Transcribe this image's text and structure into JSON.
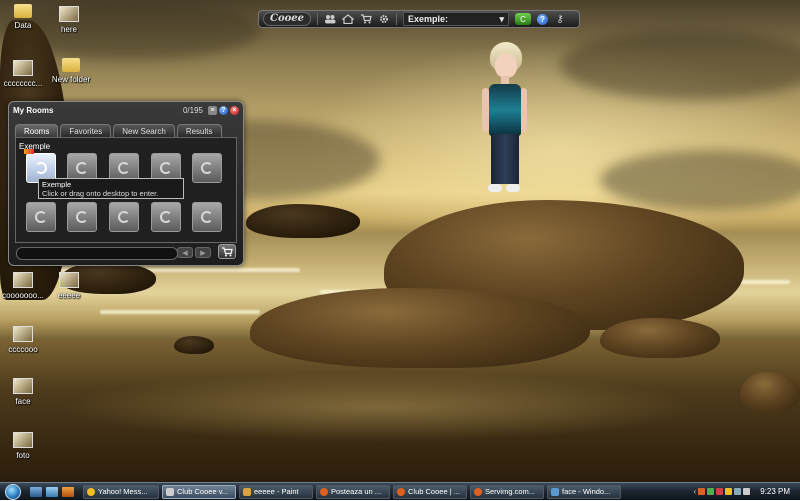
{
  "desktop_icons": [
    {
      "label": "Data",
      "type": "folder"
    },
    {
      "label": "here",
      "type": "image"
    },
    {
      "label": "cccccccc...",
      "type": "image"
    },
    {
      "label": "New folder",
      "type": "folder"
    },
    {
      "label": "cooooooo...",
      "type": "image"
    },
    {
      "label": "eeeee",
      "type": "image"
    },
    {
      "label": "ccccooo",
      "type": "image"
    },
    {
      "label": "face",
      "type": "image"
    },
    {
      "label": "foto",
      "type": "image"
    }
  ],
  "cooee_toolbar": {
    "logo": "Cooee",
    "icons": [
      "people-icon",
      "home-icon",
      "cart-icon",
      "gear-icon"
    ],
    "room_select": "Exemple:",
    "help": "?"
  },
  "rooms_window": {
    "title": "My Rooms",
    "count": "0/195",
    "tabs": [
      "Rooms",
      "Favorites",
      "New Search",
      "Results"
    ],
    "active_tab": "Rooms",
    "room_label": "Exemple",
    "tooltip_title": "Exemple",
    "tooltip_text": "Click or drag onto desktop to enter."
  },
  "taskbar": {
    "tasks": [
      {
        "label": "Yahoo! Mess...",
        "color": "#f0c020"
      },
      {
        "label": "Club Cooee v...",
        "color": "#cccccc",
        "active": true
      },
      {
        "label": "eeeee - Paint",
        "color": "#e0a040"
      },
      {
        "label": "Posteaza un ...",
        "color": "#e06020"
      },
      {
        "label": "Club Cooee | ...",
        "color": "#e06020"
      },
      {
        "label": "Servimg.com...",
        "color": "#e06020"
      },
      {
        "label": "face - Windo...",
        "color": "#5a9ad0"
      }
    ],
    "clock": "9:23 PM"
  }
}
